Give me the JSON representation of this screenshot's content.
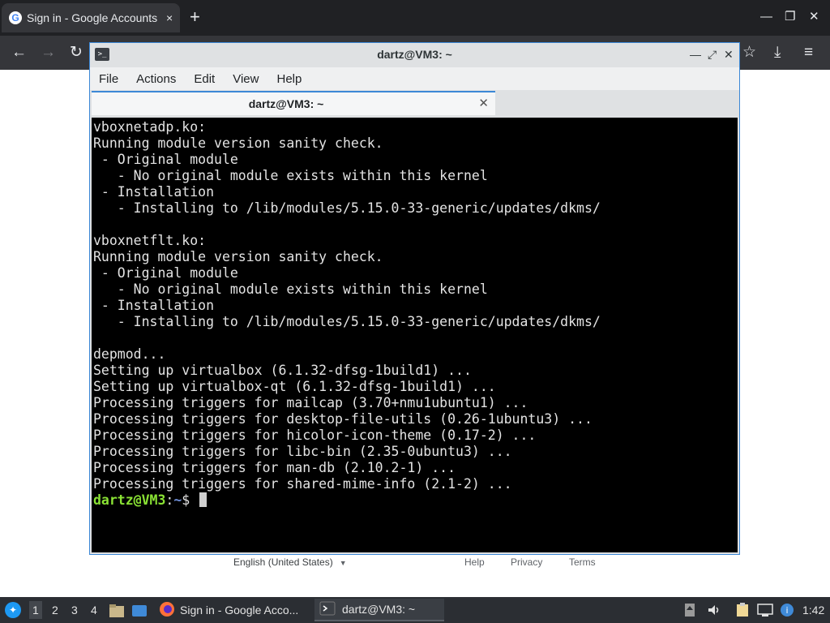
{
  "browser": {
    "tab_title": "Sign in - Google Accounts",
    "tab_close": "×",
    "new_tab": "+",
    "favicon_letter": "G",
    "window_min": "—",
    "window_restore": "❐",
    "window_close": "✕",
    "nav_back": "←",
    "nav_forward": "→",
    "nav_reload": "↻",
    "bookmark_star": "☆",
    "download": "⤓",
    "menu": "≡"
  },
  "page": {
    "language": "English (United States)",
    "language_caret": "▼",
    "help": "Help",
    "privacy": "Privacy",
    "terms": "Terms"
  },
  "terminal": {
    "window_title": "dartz@VM3: ~",
    "app_icon": ">_",
    "ctl_min": "—",
    "ctl_max": "⤢",
    "ctl_close": "✕",
    "menu": [
      "File",
      "Actions",
      "Edit",
      "View",
      "Help"
    ],
    "tab_label": "dartz@VM3: ~",
    "tab_close": "✕",
    "lines": [
      "vboxnetadp.ko:",
      "Running module version sanity check.",
      " - Original module",
      "   - No original module exists within this kernel",
      " - Installation",
      "   - Installing to /lib/modules/5.15.0-33-generic/updates/dkms/",
      "",
      "vboxnetflt.ko:",
      "Running module version sanity check.",
      " - Original module",
      "   - No original module exists within this kernel",
      " - Installation",
      "   - Installing to /lib/modules/5.15.0-33-generic/updates/dkms/",
      "",
      "depmod...",
      "Setting up virtualbox (6.1.32-dfsg-1build1) ...",
      "Setting up virtualbox-qt (6.1.32-dfsg-1build1) ...",
      "Processing triggers for mailcap (3.70+nmu1ubuntu1) ...",
      "Processing triggers for desktop-file-utils (0.26-1ubuntu3) ...",
      "Processing triggers for hicolor-icon-theme (0.17-2) ...",
      "Processing triggers for libc-bin (2.35-0ubuntu3) ...",
      "Processing triggers for man-db (2.10.2-1) ...",
      "Processing triggers for shared-mime-info (2.1-2) ..."
    ],
    "prompt_user": "dartz@VM3",
    "prompt_sep": ":",
    "prompt_path": "~",
    "prompt_symbol": "$ "
  },
  "taskbar": {
    "workspaces": [
      "1",
      "2",
      "3",
      "4"
    ],
    "tasks": [
      {
        "label": "Sign in - Google Acco...",
        "icon": "firefox-icon"
      },
      {
        "label": "dartz@VM3: ~",
        "icon": "terminal-icon"
      }
    ],
    "clock": "1:42"
  },
  "colors": {
    "accent": "#3c88d6",
    "prompt_user": "#8ae234",
    "prompt_path": "#6f8fd8",
    "terminal_bg": "#000000"
  }
}
